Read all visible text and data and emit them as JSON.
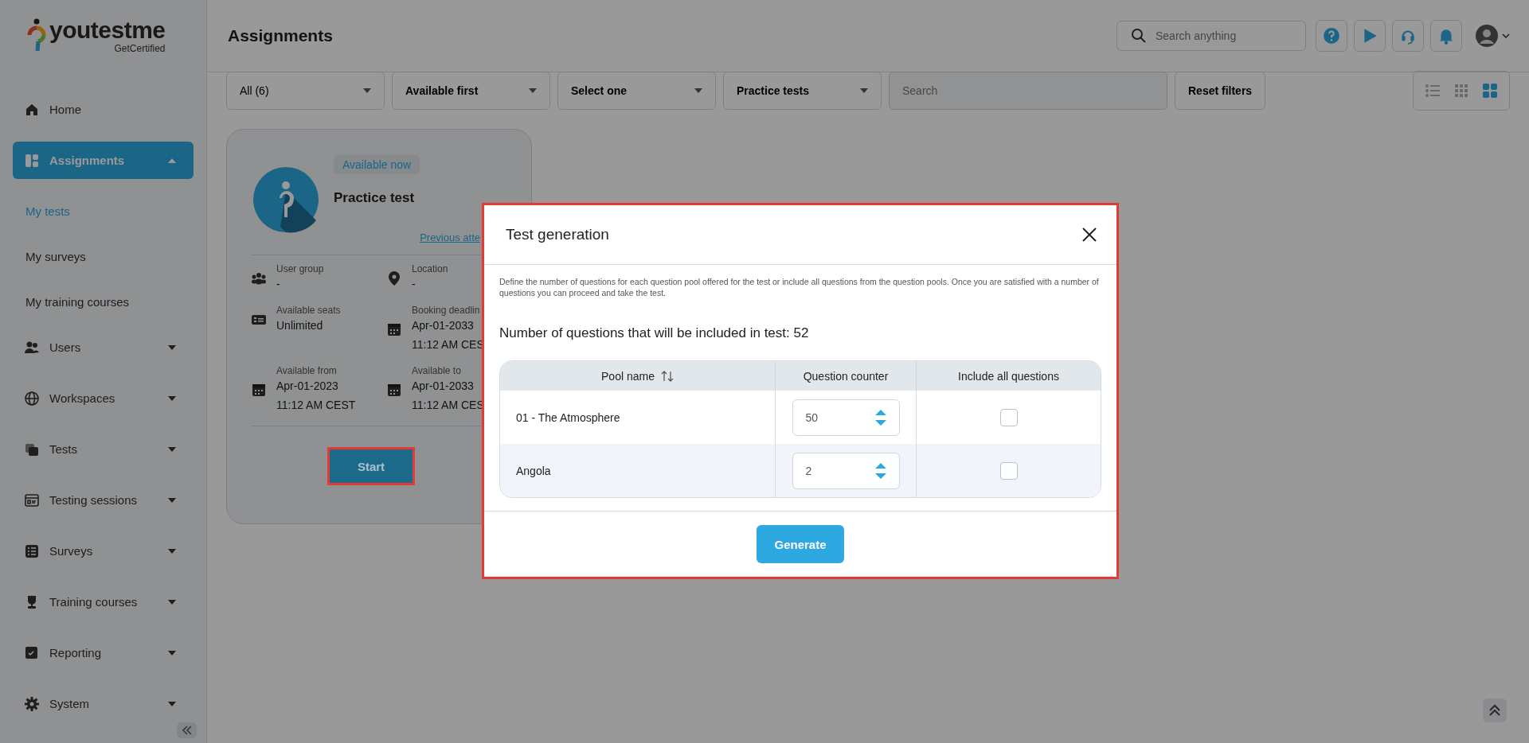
{
  "logo": {
    "name": "youtestme",
    "tagline": "GetCertified"
  },
  "sidebar": {
    "items": [
      {
        "label": "Home",
        "selected": false
      },
      {
        "label": "Assignments",
        "selected": true,
        "expanded": true,
        "children": [
          {
            "label": "My tests",
            "selected": true
          },
          {
            "label": "My surveys",
            "selected": false
          },
          {
            "label": "My training courses",
            "selected": false
          }
        ]
      },
      {
        "label": "Users",
        "selected": false,
        "expanded": false
      },
      {
        "label": "Workspaces",
        "selected": false,
        "expanded": false
      },
      {
        "label": "Tests",
        "selected": false,
        "expanded": false
      },
      {
        "label": "Testing sessions",
        "selected": false,
        "expanded": false
      },
      {
        "label": "Surveys",
        "selected": false,
        "expanded": false
      },
      {
        "label": "Training courses",
        "selected": false,
        "expanded": false
      },
      {
        "label": "Reporting",
        "selected": false,
        "expanded": false
      },
      {
        "label": "System",
        "selected": false,
        "expanded": false
      }
    ]
  },
  "header": {
    "title": "Assignments",
    "search": {
      "placeholder": "Search anything"
    }
  },
  "filters": {
    "dropdowns": [
      "All (6)",
      "Available first",
      "Select one",
      "Practice tests"
    ],
    "search": {
      "placeholder": "Search"
    },
    "reset": "Reset filters",
    "view_modes": [
      {
        "selected": false
      },
      {
        "selected": false
      },
      {
        "selected": true
      }
    ]
  },
  "card": {
    "badge": "Available now",
    "title": "Practice test",
    "link": "Previous atte",
    "fields": [
      {
        "label": "User group",
        "lines": [
          "-"
        ]
      },
      {
        "label": "Location",
        "lines": [
          "-"
        ]
      },
      {
        "label": "Available seats",
        "lines": [
          "Unlimited"
        ]
      },
      {
        "label": "Booking deadlin",
        "lines": [
          "Apr-01-2033",
          "11:12 AM CES"
        ]
      },
      {
        "label": "Available from",
        "lines": [
          "Apr-01-2023",
          "11:12 AM CEST"
        ]
      },
      {
        "label": "Available to",
        "lines": [
          "Apr-01-2033",
          "11:12 AM CES"
        ]
      }
    ],
    "button": "Start"
  },
  "dialog": {
    "title": "Test generation",
    "description": "Define the number of questions for each question pool offered for the test or include all questions from the question pools. Once you are satisfied with a number of questions you can proceed and take the test.",
    "summary": "Number of questions that will be included in test: 52",
    "columns": [
      "Pool name",
      "Question counter",
      "Include all questions"
    ],
    "rows": [
      {
        "pool": "01 - The Atmosphere",
        "counter": "50",
        "include_all": false
      },
      {
        "pool": "Angola",
        "counter": "2",
        "include_all": false
      }
    ],
    "button": "Generate"
  }
}
